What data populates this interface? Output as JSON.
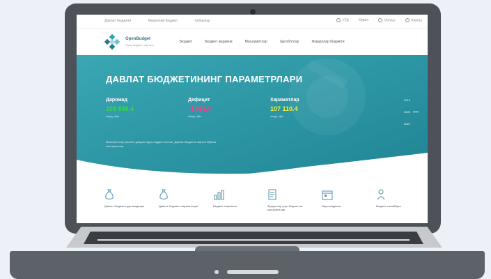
{
  "topbar": {
    "links": [
      "Давлат бюджети",
      "Маҳаллий бюджет",
      "Хабарлар"
    ],
    "right": [
      "УЗБ",
      "Кирил",
      "Излаш",
      "Кириш"
    ]
  },
  "brand": {
    "name": "OpenBudget",
    "tagline": "Очиқ бюджет портали"
  },
  "menu": [
    "Бюджет",
    "Бюджет жараёни",
    "Маълумотлар",
    "Ҳисоботлар",
    "Фуқаролар бюджети"
  ],
  "hero": {
    "title": "ДАВЛАТ БЮДЖЕТИНИНГ ПАРАМЕТРЛАРИ",
    "stats": [
      {
        "label": "Даромад",
        "value": "103 858.4",
        "unit": "млрд. сўм",
        "color": "#39d353"
      },
      {
        "label": "Дефицит",
        "value": "-4 065.4",
        "unit": "млрд. сўм",
        "color": "#ff3d8b"
      },
      {
        "label": "Харажатлар",
        "value": "107 110.4",
        "unit": "млрд. сўм",
        "color": "#f5ee3a"
      }
    ],
    "note": "Маълумотлар ҳисобот даврига кўра тақдим этилган. Давлат бюджети ижроси бўйича маълумотлар.",
    "side_links": [
      "2019",
      "2020",
      "2021"
    ]
  },
  "icons": [
    {
      "icon": "money-bag-icon",
      "caption": "Давлат бюджети даромадлари"
    },
    {
      "icon": "money-bag-icon",
      "caption": "Давлат бюджети харажатлари"
    },
    {
      "icon": "bar-chart-icon",
      "caption": "Бюджет тақсимоти"
    },
    {
      "icon": "document-icon",
      "caption": "Фуқаролар учун бюджет ва маълумотлар"
    },
    {
      "icon": "calendar-icon",
      "caption": "Ижро жадвали"
    },
    {
      "icon": "person-icon",
      "caption": "Бюджет ташаббуси"
    }
  ],
  "colors": {
    "hero_teal": "#2f9aa8",
    "hero_dark": "#1f7f8d",
    "laptop_body": "#4d5258"
  }
}
